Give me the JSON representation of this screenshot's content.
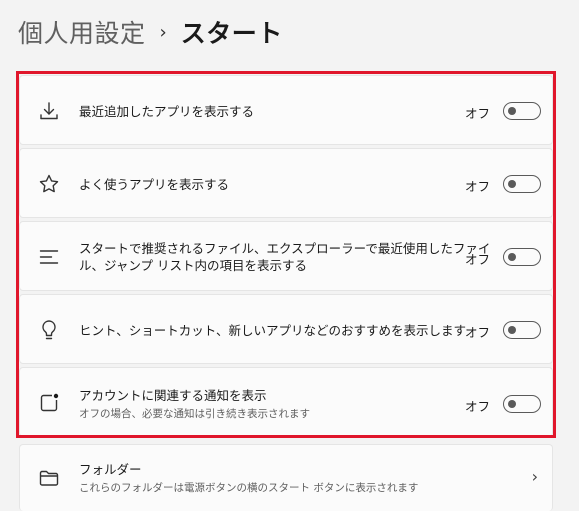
{
  "breadcrumb": {
    "parent": "個人用設定",
    "separator": "›",
    "current": "スタート"
  },
  "settings": [
    {
      "icon": "download-icon",
      "label": "最近追加したアプリを表示する",
      "state": "オフ",
      "toggle_on": false
    },
    {
      "icon": "star-icon",
      "label": "よく使うアプリを表示する",
      "state": "オフ",
      "toggle_on": false
    },
    {
      "icon": "list-icon",
      "label_line1": "スタートで推奨されるファイル、エクスプローラーで最近使用したファイ",
      "label_line2": "ル、ジャンプ リスト内の項目を表示する",
      "state": "オフ",
      "toggle_on": false
    },
    {
      "icon": "lightbulb-icon",
      "label": "ヒント、ショートカット、新しいアプリなどのおすすめを表示します",
      "state": "オフ",
      "toggle_on": false
    },
    {
      "icon": "notification-icon",
      "label": "アカウントに関連する通知を表示",
      "sublabel": "オフの場合、必要な通知は引き続き表示されます",
      "state": "オフ",
      "toggle_on": false
    }
  ],
  "folders": {
    "icon": "folder-icon",
    "label": "フォルダー",
    "sublabel": "これらのフォルダーは電源ボタンの横のスタート ボタンに表示されます"
  },
  "colors": {
    "highlight": "#e0162b",
    "background": "#f3f3f3",
    "card": "#fbfbfb"
  }
}
